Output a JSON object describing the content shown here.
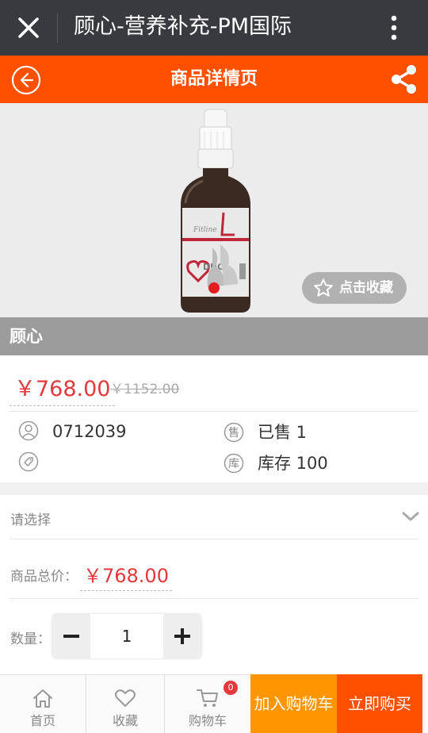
{
  "wechat_bar": {
    "title": "顾心-营养补充-PM国际"
  },
  "header": {
    "title": "商品详情页"
  },
  "gallery": {
    "favorite_label": "点击收藏"
  },
  "product": {
    "name": "顾心",
    "price": "￥768.00",
    "original_price": "￥1152.00",
    "code": "0712039",
    "sold_icon_char": "售",
    "sold_text": "已售 1",
    "stock_icon_char": "库",
    "stock_text": "库存 100"
  },
  "options": {
    "select_label": "请选择",
    "total_label": "商品总价：",
    "total_price": "￥768.00",
    "quantity_label": "数量：",
    "quantity_value": "1"
  },
  "tabbar": {
    "home_label": "首页",
    "favorite_label": "收藏",
    "cart_label": "购物车",
    "cart_count": "0",
    "add_to_cart_label": "加入购物车",
    "buy_now_label": "立即购买"
  },
  "colors": {
    "brand_orange": "#ff5000",
    "cart_orange": "#ff9500",
    "price_red": "#e4393c",
    "wechat_bar": "#393a3f"
  },
  "icons": [
    "close-icon",
    "more-icon",
    "back-icon",
    "share-icon",
    "star-icon",
    "user-icon",
    "tag-icon",
    "chevron-down-icon",
    "home-icon",
    "heart-icon",
    "cart-icon"
  ]
}
